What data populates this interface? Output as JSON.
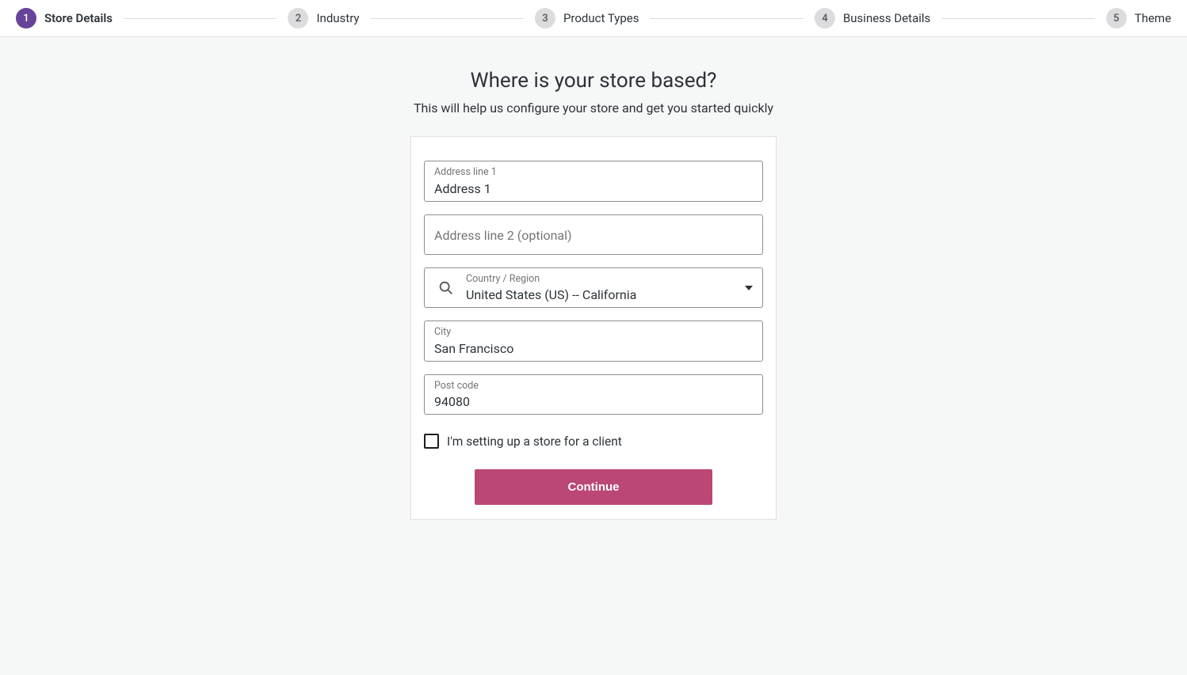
{
  "stepper": {
    "steps": [
      {
        "num": "1",
        "label": "Store Details"
      },
      {
        "num": "2",
        "label": "Industry"
      },
      {
        "num": "3",
        "label": "Product Types"
      },
      {
        "num": "4",
        "label": "Business Details"
      },
      {
        "num": "5",
        "label": "Theme"
      }
    ]
  },
  "header": {
    "title": "Where is your store based?",
    "subtitle": "This will help us configure your store and get you started quickly"
  },
  "form": {
    "address1": {
      "label": "Address line 1",
      "value": "Address 1"
    },
    "address2": {
      "placeholder": "Address line 2 (optional)",
      "value": ""
    },
    "country": {
      "label": "Country / Region",
      "value": "United States (US) -- California"
    },
    "city": {
      "label": "City",
      "value": "San Francisco"
    },
    "postcode": {
      "label": "Post code",
      "value": "94080"
    },
    "client_checkbox": {
      "label": "I'm setting up a store for a client",
      "checked": false
    },
    "continue_label": "Continue"
  }
}
